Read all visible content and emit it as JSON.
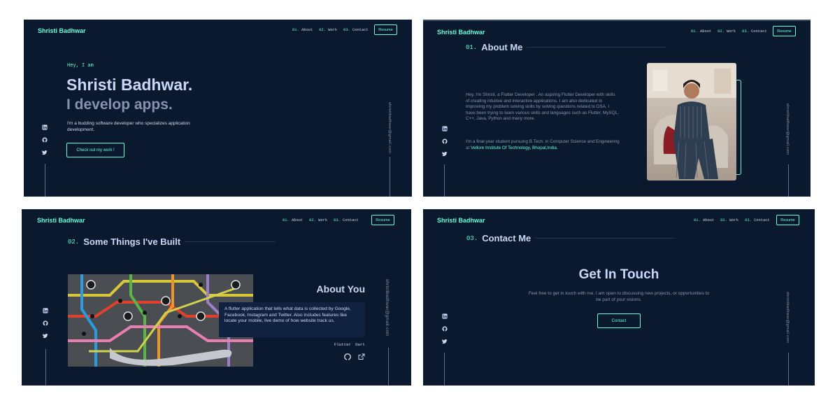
{
  "site": {
    "logo": "Shristi Badhwar",
    "nav": [
      {
        "num": "01.",
        "label": "About"
      },
      {
        "num": "02.",
        "label": "Work"
      },
      {
        "num": "03.",
        "label": "Contact"
      }
    ],
    "resume_label": "Resume",
    "email": "shristibadhwar@gmail.com",
    "socials": [
      "linkedin-icon",
      "github-icon",
      "twitter-icon"
    ]
  },
  "hero": {
    "greeting": "Hey, I am",
    "name": "Shristi Badhwar.",
    "tagline": "I develop apps.",
    "description": "I'm a budding software developer who specializes application development.",
    "cta": "Check out my work !"
  },
  "about": {
    "num": "01.",
    "title": "About Me",
    "para1": "Hey, I'm Shristi, a Flutter Developer . An aspiring Flutter Developer with skills of creating intuitive and interactive applications. I am also dedicated to improving my problem solving skills by solving questions related to DSA. I have been trying to learn various skills and languages such as Flutter, MySQL, C++, Java, Python and many more.",
    "para2_prefix": "I'm a final year student pursuing B.Tech. in Computer Science and Engineering at ",
    "para2_link": "Vellore Institute Of Technology, Bhopal,India."
  },
  "work": {
    "num": "02.",
    "title": "Some Things I've Built",
    "project": {
      "title": "About You",
      "description": "A flutter application that tells what data is collected by Google, Facebook, Instagram and Twitter. Also includes features like locate your mobile, live demo of how website track us.",
      "tech": [
        "Flutter",
        "Dart"
      ]
    }
  },
  "contact": {
    "num": "03.",
    "title": "Contact Me",
    "heading": "Get In Touch",
    "description": "Feel free to get in touch with me. I am open to discussing new projects, or opportunities to be part of your visions.",
    "cta": "Contact"
  },
  "colors": {
    "background": "#0b192f",
    "accent": "#64ffda",
    "text_light": "#ccd6f6",
    "text_muted": "#8892b0"
  }
}
